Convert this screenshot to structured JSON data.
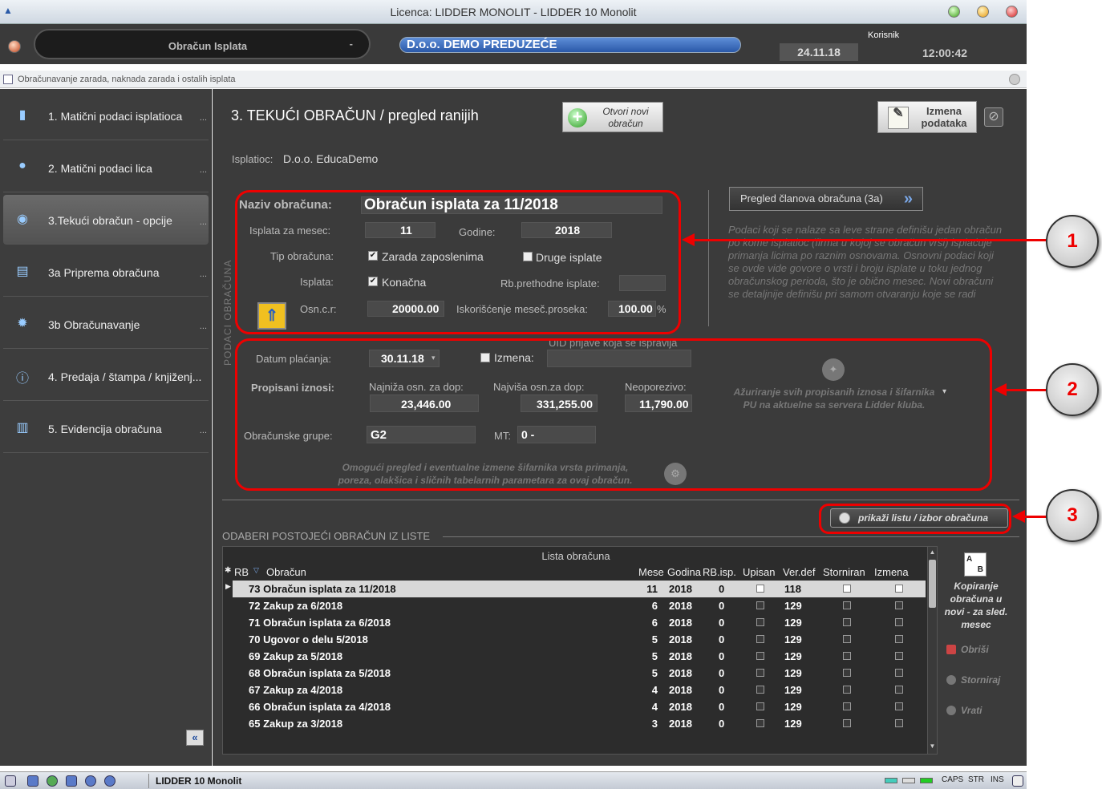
{
  "window": {
    "title": "Licenca: LIDDER MONOLIT - LIDDER 10 Monolit",
    "app_icon": "app-logo-icon"
  },
  "header": {
    "module": "Obračun Isplata",
    "module_dash": "-",
    "company": "D.o.o. DEMO PREDUZEĆE",
    "user_label": "Korisnik",
    "date": "24.11.18",
    "time": "12:00:42"
  },
  "substrip": {
    "text": "Obračunavanje zarada, naknada zarada i ostalih isplata"
  },
  "sidebar": {
    "items": [
      {
        "label": "1. Matični podaci isplatioca",
        "icon": "building-icon",
        "dots": "..."
      },
      {
        "label": "2. Matični podaci lica",
        "icon": "person-icon",
        "dots": "..."
      },
      {
        "label": "3.Tekući obračun - opcije",
        "icon": "coins-check-icon",
        "dots": "..."
      },
      {
        "label": "3a Priprema obračuna",
        "icon": "document-list-icon",
        "dots": "..."
      },
      {
        "label": "3b Obračunavanje",
        "icon": "coins-gear-icon",
        "dots": "..."
      },
      {
        "label": "4. Predaja / štampa / knjiženj...",
        "icon": "document-info-icon",
        "dots": ""
      },
      {
        "label": "5. Evidencija obračuna",
        "icon": "archive-icon",
        "dots": "..."
      }
    ],
    "collapse_label": "«"
  },
  "main": {
    "title": "3. TEKUĆI OBRAČUN / pregled ranijih",
    "new_button": "Otvori novi obračun",
    "edit_button": "Izmena podataka",
    "isplatioc_label": "Isplatioc:",
    "isplatioc_value": "D.o.o. EducaDemo",
    "vertical_label": "PODACI OBRAČUNA",
    "naziv_label": "Naziv obračuna:",
    "naziv_value": "Obračun isplata za 11/2018",
    "isplata_mesec_label": "Isplata za mesec:",
    "isplata_mesec_value": "11",
    "godine_label": "Godine:",
    "godine_value": "2018",
    "tip_label": "Tip obračuna:",
    "tip_zarada": "Zarada zaposlenima",
    "tip_druge": "Druge isplate",
    "isplata_label": "Isplata:",
    "isplata_konacna": "Konačna",
    "rb_prethodne_label": "Rb.prethodne isplate:",
    "osn_label": "Osn.c.r:",
    "osn_value": "20000.00",
    "iskoriscenje_label": "Iskorišćenje meseč.proseka:",
    "iskoriscenje_value": "100.00",
    "iskoriscenje_unit": "%",
    "pregled_button": "Pregled članova obračuna (3a)",
    "info_text": "Podaci koji se nalaze sa leve strane definišu jedan obračun po kome isplatioc (firma u kojoj se obračun vrši) isplaćuje primanja licima po raznim osnovama. Osnovni podaci koji se ovde vide govore o vrsti i broju isplate u toku jednog obračunskog perioda, što je obično mesec. Novi obračuni se detaljnije definišu pri samom otvaranju koje se radi",
    "datum_label": "Datum plaćanja:",
    "datum_value": "30.11.18",
    "izmena_label": "Izmena:",
    "uid_label": "UID prijave koja se ispravlja",
    "propisani_label": "Propisani iznosi:",
    "najniza_label": "Najniža osn. za dop:",
    "najniza_value": "23,446.00",
    "najvisa_label": "Najviša osn.za dop:",
    "najvisa_value": "331,255.00",
    "neoporezivo_label": "Neoporezivo:",
    "neoporezivo_value": "11,790.00",
    "sync_text": "Ažuriranje svih propisanih iznosa i šifarnika PU na aktuelne sa servera Lidder kluba.",
    "grupe_label": "Obračunske grupe:",
    "grupe_value": "G2",
    "mt_label": "MT:",
    "mt_value": "0 -",
    "omoguci_text": "Omogući pregled i eventualne izmene šifarnika vrsta primanja, poreza, olakšica i sličnih tabelarnih parametara za ovaj obračun.",
    "prikazi_button": "prikaži listu / izbor obračuna",
    "section_label": "ODABERI POSTOJEĆI OBRAČUN IZ LISTE"
  },
  "list": {
    "title": "Lista obračuna",
    "columns": [
      "RB",
      "Obračun",
      "Mese",
      "Godina",
      "RB.isp.",
      "Upisan",
      "Ver.def",
      "Storniran",
      "Izmena"
    ],
    "rows": [
      {
        "name": "73 Obračun isplata za 11/2018",
        "mesec": "11",
        "godina": "2018",
        "rbisp": "0",
        "verdef": "118"
      },
      {
        "name": "72 Zakup za 6/2018",
        "mesec": "6",
        "godina": "2018",
        "rbisp": "0",
        "verdef": "129"
      },
      {
        "name": "71 Obračun isplata za 6/2018",
        "mesec": "6",
        "godina": "2018",
        "rbisp": "0",
        "verdef": "129"
      },
      {
        "name": "70 Ugovor o delu 5/2018",
        "mesec": "5",
        "godina": "2018",
        "rbisp": "0",
        "verdef": "129"
      },
      {
        "name": "69 Zakup za 5/2018",
        "mesec": "5",
        "godina": "2018",
        "rbisp": "0",
        "verdef": "129"
      },
      {
        "name": "68 Obračun isplata za 5/2018",
        "mesec": "5",
        "godina": "2018",
        "rbisp": "0",
        "verdef": "129"
      },
      {
        "name": "67 Zakup za 4/2018",
        "mesec": "4",
        "godina": "2018",
        "rbisp": "0",
        "verdef": "129"
      },
      {
        "name": "66 Obračun isplata za 4/2018",
        "mesec": "4",
        "godina": "2018",
        "rbisp": "0",
        "verdef": "129"
      },
      {
        "name": "65 Zakup za 3/2018",
        "mesec": "3",
        "godina": "2018",
        "rbisp": "0",
        "verdef": "129"
      }
    ],
    "kopiranje_text": "Kopiranje obračuna u novi - za sled. mesec",
    "obrisi": "Obriši",
    "storniraj": "Storniraj",
    "vrati": "Vrati"
  },
  "annotations": {
    "badge1": "1",
    "badge2": "2",
    "badge3": "3",
    "color": "#e00000"
  },
  "taskbar": {
    "label": "LIDDER 10 Monolit",
    "caps": "CAPS",
    "str": "STR",
    "ins": "INS"
  }
}
